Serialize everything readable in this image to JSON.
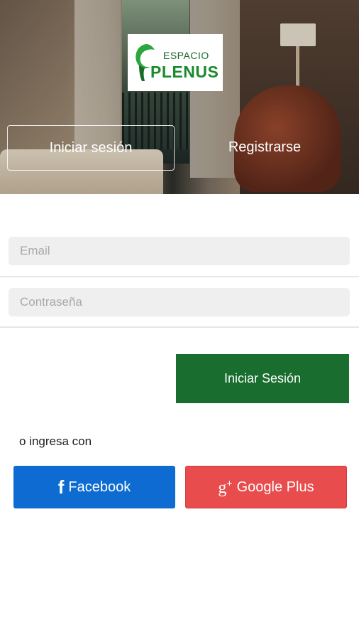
{
  "logo": {
    "top_text": "ESPACIO",
    "main_text": "PLENUS"
  },
  "tabs": {
    "login": "Iniciar sesión",
    "register": "Registrarse"
  },
  "form": {
    "email_placeholder": "Email",
    "password_placeholder": "Contraseña",
    "submit_label": "Iniciar Sesión"
  },
  "social": {
    "prompt": "o ingresa con",
    "facebook": {
      "icon": "facebook-icon",
      "glyph": "f",
      "label": "Facebook"
    },
    "google": {
      "icon": "google-plus-icon",
      "glyph": "g",
      "glyph_sup": "+",
      "label": "Google Plus"
    }
  },
  "colors": {
    "brand_green": "#196d2e",
    "facebook_blue": "#0d6bd1",
    "google_red": "#e94c4c",
    "input_bg": "#efefef"
  }
}
